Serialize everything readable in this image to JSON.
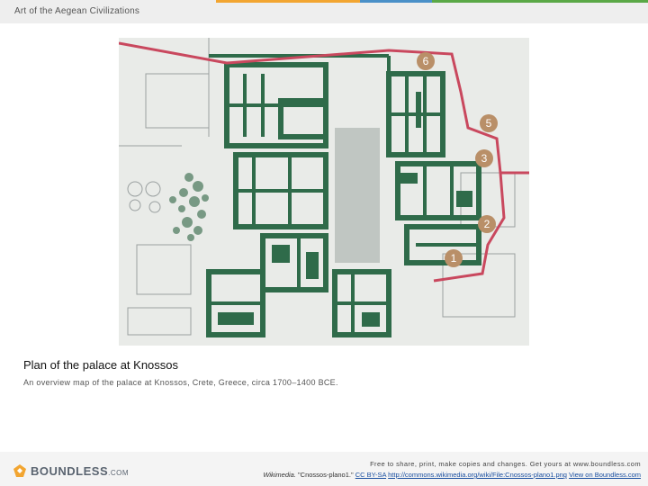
{
  "header": {
    "title": "Art of the Aegean Civilizations",
    "accent_colors": [
      "#f2a531",
      "#4a90c8",
      "#5aa846"
    ]
  },
  "figure": {
    "alt": "Plan of the palace at Knossos",
    "site_markers": [
      "6",
      "5",
      "3",
      "2",
      "1"
    ],
    "colors": {
      "walls": "#2f6b4a",
      "route": "#c9485e",
      "ground": "#e9ebe8",
      "marker": "#b98f68"
    }
  },
  "caption": {
    "title": "Plan of the palace at Knossos",
    "description": "An overview map of the palace at Knossos, Crete, Greece, circa 1700–1400 BCE."
  },
  "footer": {
    "brand": "BOUNDLESS",
    "brand_suffix": ".COM",
    "free_share": "Free to share, print, make copies and changes. Get yours at www.boundless.com",
    "source": "Wikimedia.",
    "source_title": "\"Cnossos-plano1.\"",
    "license": "CC BY-SA",
    "link": "http://commons.wikimedia.org/wiki/File:Cnossos-plano1.png",
    "view_link": "View on Boundless.com"
  }
}
